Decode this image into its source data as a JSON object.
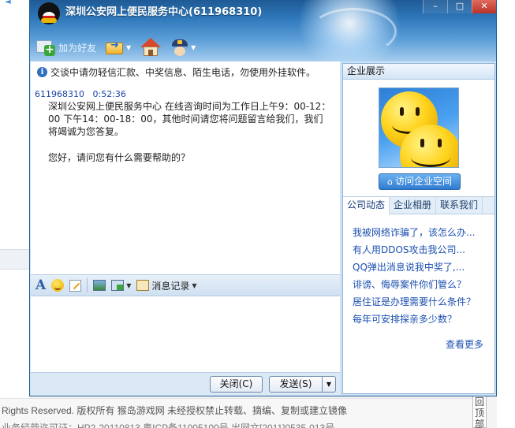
{
  "window": {
    "title": "深圳公安网上便民服务中心(611968310)",
    "controls": {
      "minimize": "–",
      "maximize": "□",
      "close": "✕"
    }
  },
  "toolbar": {
    "add_friend_label": "加为好友"
  },
  "chat": {
    "notice": "交谈中请勿轻信汇款、中奖信息、陌生电话，勿使用外挂软件。",
    "message": {
      "sender_id": "611968310",
      "time": "0:52:36",
      "body": "深圳公安网上便民服务中心 在线咨询时间为工作日上午9：00-12：00 下午14：00-18：00，其他时间请您将问题留言给我们，我们将竭诚为您答复。",
      "question": "您好，请问您有什么需要帮助的？"
    }
  },
  "format_bar": {
    "font_glyph": "A",
    "history_label": "消息记录"
  },
  "buttons": {
    "close_label": "关闭(C)",
    "send_label": "发送(S)",
    "send_arrow": "▼"
  },
  "panel": {
    "header": "企业展示",
    "visit_label": "访问企业空间",
    "tabs": [
      "公司动态",
      "企业相册",
      "联系我们"
    ],
    "news": [
      "我被网络诈骗了，该怎么办...",
      "有人用DDOS攻击我公司...",
      "QQ弹出消息说我中奖了,...",
      "诽谤、侮辱案件你们管么？",
      "居住证是办理需要什么条件？",
      "每年可安排探亲多少数？"
    ],
    "more_label": "查看更多"
  },
  "background_page": {
    "footer_line1": "Rights Reserved. 版权所有 猴岛游戏网 未经授权禁止转载、摘编、复制或建立镜像",
    "footer_line2": "业务经营许可证：HP2-20110813 粤ICP备11005100号 出网文[2011]0535-013号",
    "back_top": "回\n顶\n部"
  },
  "colors": {
    "title_bar": "#2f78bb",
    "link": "#1b4fb0",
    "sender": "#1b43a8"
  }
}
